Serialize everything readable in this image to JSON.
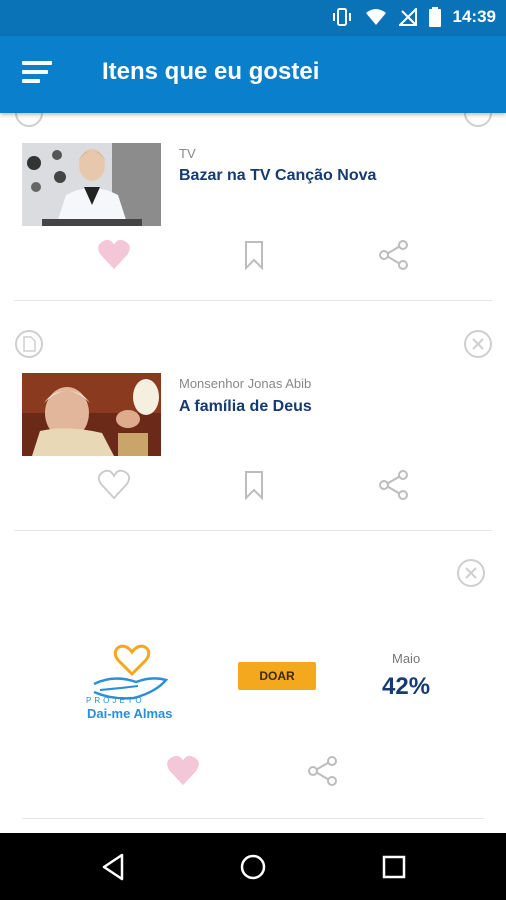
{
  "status_bar": {
    "time": "14:39"
  },
  "app_bar": {
    "title": "Itens que eu gostei"
  },
  "items": [
    {
      "category": "TV",
      "title": "Bazar na TV Canção Nova",
      "liked": true
    },
    {
      "category": "Monsenhor Jonas Abib",
      "title": "A família de Deus",
      "liked": false
    }
  ],
  "donation": {
    "logo_small": "PROJETO",
    "logo_name": "Dai-me Almas",
    "button_label": "DOAR",
    "month": "Maio",
    "percent": "42%",
    "liked": true
  },
  "colors": {
    "primary": "#0a7fcb",
    "title_text": "#163a72",
    "donate_button": "#f4a81d",
    "liked_heart": "#f4c7d8"
  }
}
